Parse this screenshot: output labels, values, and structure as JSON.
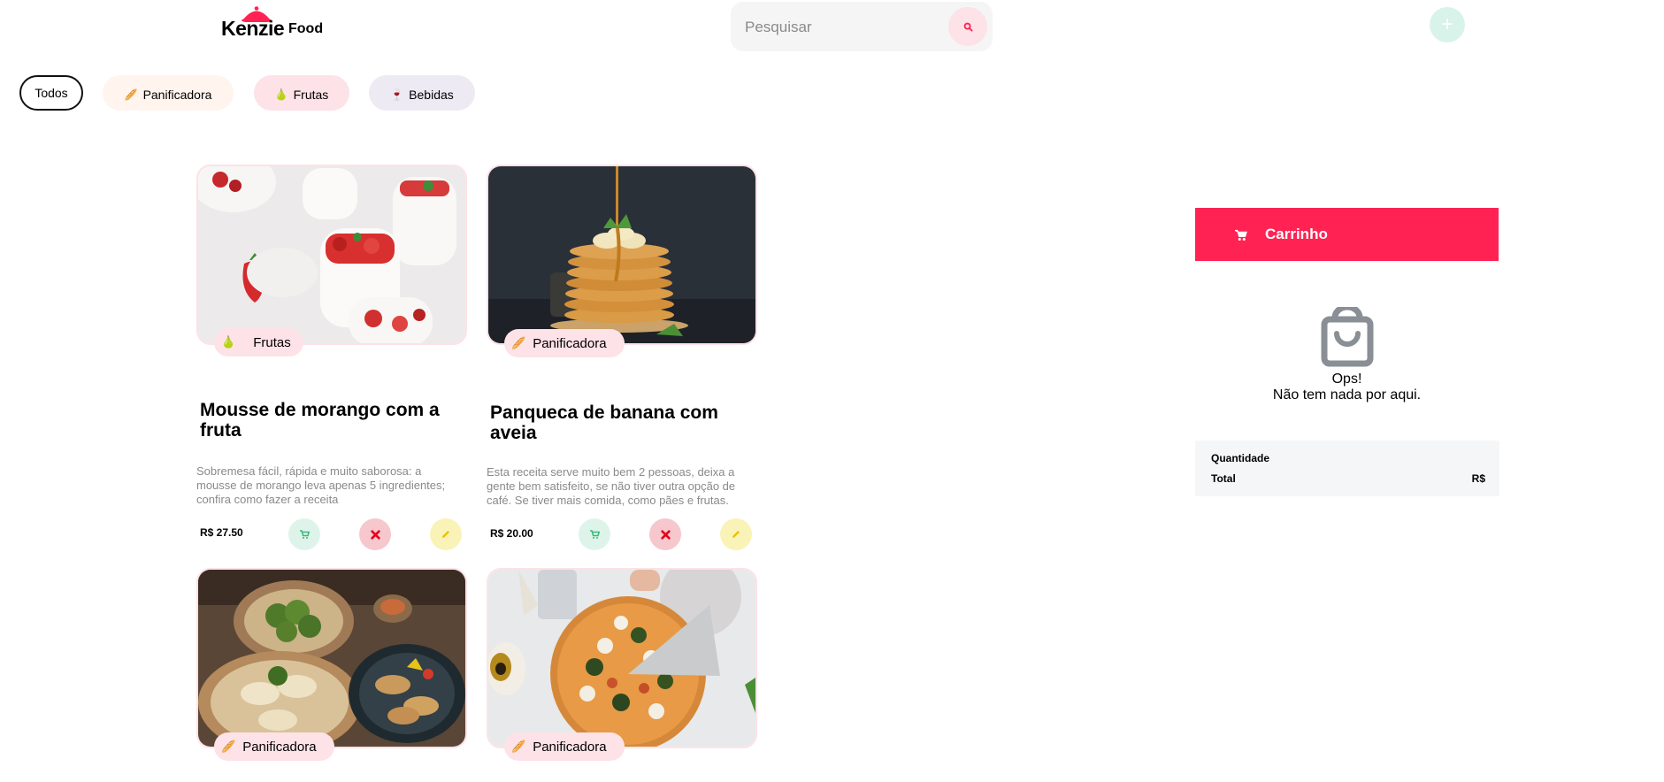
{
  "header": {
    "logo_main": "Kenzie",
    "logo_sub": "Food",
    "search_placeholder": "Pesquisar",
    "search_value": "",
    "add_label": "+"
  },
  "filters": [
    {
      "label": "Todos",
      "icon": ""
    },
    {
      "label": "Panificadora",
      "icon": "🥖"
    },
    {
      "label": "Frutas",
      "icon": "🍐"
    },
    {
      "label": "Bebidas",
      "icon": "🍷"
    }
  ],
  "products": [
    {
      "tag": "Frutas",
      "tag_icon": "🍐",
      "title": "Mousse de morango com a fruta",
      "description": "Sobremesa fácil, rápida e muito saborosa: a mousse de morango leva apenas 5 ingredientes; confira como fazer a receita",
      "price": "R$ 27.50"
    },
    {
      "tag": "Panificadora",
      "tag_icon": "🥖",
      "title": "Panqueca de banana com aveia",
      "description": "Esta receita serve muito bem 2 pessoas, deixa a gente bem satisfeito, se não tiver outra opção de café. Se tiver mais comida, como pães e frutas.",
      "price": "R$ 20.00"
    },
    {
      "tag": "Panificadora",
      "tag_icon": "🥖"
    },
    {
      "tag": "Panificadora",
      "tag_icon": "🥖"
    }
  ],
  "cart": {
    "title": "Carrinho",
    "empty_line1": "Ops!",
    "empty_line2": "Não tem nada por aqui.",
    "quantity_label": "Quantidade",
    "quantity_value": "",
    "total_label": "Total",
    "total_value": "R$"
  },
  "colors": {
    "brand": "#ff2253",
    "tag_bg": "#fde2e7",
    "cart_action": "#def4ea",
    "delete_action": "#f6c7cd",
    "edit_action": "#faf3b8"
  },
  "icons": {
    "search": "search-icon",
    "add": "plus-icon",
    "cart": "cart-icon",
    "delete": "close-icon",
    "edit": "pencil-icon",
    "empty_cart": "shopping-bag-icon"
  }
}
